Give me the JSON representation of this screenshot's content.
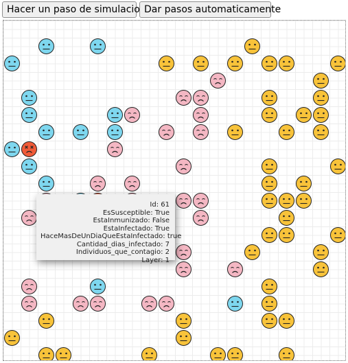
{
  "toolbar": {
    "step_label": "Hacer un paso de simulacion",
    "auto_label": "Dar pasos automaticamente"
  },
  "colors": {
    "susceptible": "#7ed7ef",
    "infected": "#f4b7c3",
    "infected_severe": "#f05a37",
    "immunized": "#f8c33a"
  },
  "agents": [
    {
      "c": 2,
      "r": 1,
      "state": "susceptible"
    },
    {
      "c": 5,
      "r": 1,
      "state": "susceptible"
    },
    {
      "c": 14,
      "r": 1,
      "state": "immunized"
    },
    {
      "c": 0,
      "r": 2,
      "state": "susceptible"
    },
    {
      "c": 9,
      "r": 2,
      "state": "immunized"
    },
    {
      "c": 11,
      "r": 2,
      "state": "immunized"
    },
    {
      "c": 13,
      "r": 2,
      "state": "immunized"
    },
    {
      "c": 15,
      "r": 2,
      "state": "immunized"
    },
    {
      "c": 16,
      "r": 2,
      "state": "immunized"
    },
    {
      "c": 19,
      "r": 2,
      "state": "immunized"
    },
    {
      "c": 12,
      "r": 3,
      "state": "infected"
    },
    {
      "c": 18,
      "r": 3,
      "state": "immunized"
    },
    {
      "c": 1,
      "r": 4,
      "state": "susceptible"
    },
    {
      "c": 10,
      "r": 4,
      "state": "infected"
    },
    {
      "c": 11,
      "r": 4,
      "state": "infected"
    },
    {
      "c": 15,
      "r": 4,
      "state": "immunized"
    },
    {
      "c": 18,
      "r": 4,
      "state": "immunized"
    },
    {
      "c": 1,
      "r": 5,
      "state": "susceptible"
    },
    {
      "c": 6,
      "r": 5,
      "state": "susceptible"
    },
    {
      "c": 7,
      "r": 5,
      "state": "infected"
    },
    {
      "c": 11,
      "r": 5,
      "state": "infected"
    },
    {
      "c": 15,
      "r": 5,
      "state": "immunized"
    },
    {
      "c": 17,
      "r": 5,
      "state": "immunized"
    },
    {
      "c": 18,
      "r": 5,
      "state": "immunized"
    },
    {
      "c": 2,
      "r": 6,
      "state": "susceptible"
    },
    {
      "c": 4,
      "r": 6,
      "state": "susceptible"
    },
    {
      "c": 6,
      "r": 6,
      "state": "susceptible"
    },
    {
      "c": 9,
      "r": 6,
      "state": "infected"
    },
    {
      "c": 11,
      "r": 6,
      "state": "infected"
    },
    {
      "c": 13,
      "r": 6,
      "state": "immunized"
    },
    {
      "c": 16,
      "r": 6,
      "state": "immunized"
    },
    {
      "c": 18,
      "r": 6,
      "state": "immunized"
    },
    {
      "c": 0,
      "r": 7,
      "state": "susceptible"
    },
    {
      "c": 1,
      "r": 7,
      "state": "infected_severe"
    },
    {
      "c": 6,
      "r": 7,
      "state": "infected"
    },
    {
      "c": 1,
      "r": 8,
      "state": "susceptible"
    },
    {
      "c": 10,
      "r": 8,
      "state": "infected"
    },
    {
      "c": 15,
      "r": 8,
      "state": "immunized"
    },
    {
      "c": 19,
      "r": 8,
      "state": "immunized"
    },
    {
      "c": 2,
      "r": 9,
      "state": "susceptible"
    },
    {
      "c": 5,
      "r": 9,
      "state": "infected"
    },
    {
      "c": 7,
      "r": 9,
      "state": "infected"
    },
    {
      "c": 15,
      "r": 9,
      "state": "immunized"
    },
    {
      "c": 17,
      "r": 9,
      "state": "immunized"
    },
    {
      "c": 2,
      "r": 10,
      "state": "infected"
    },
    {
      "c": 4,
      "r": 10,
      "state": "susceptible"
    },
    {
      "c": 5,
      "r": 10,
      "state": "infected_severe"
    },
    {
      "c": 7,
      "r": 10,
      "state": "infected"
    },
    {
      "c": 10,
      "r": 10,
      "state": "infected"
    },
    {
      "c": 11,
      "r": 10,
      "state": "infected"
    },
    {
      "c": 15,
      "r": 10,
      "state": "immunized"
    },
    {
      "c": 16,
      "r": 10,
      "state": "immunized"
    },
    {
      "c": 17,
      "r": 10,
      "state": "immunized"
    },
    {
      "c": 1,
      "r": 11,
      "state": "infected"
    },
    {
      "c": 11,
      "r": 11,
      "state": "infected"
    },
    {
      "c": 16,
      "r": 11,
      "state": "immunized"
    },
    {
      "c": 15,
      "r": 12,
      "state": "immunized"
    },
    {
      "c": 16,
      "r": 12,
      "state": "immunized"
    },
    {
      "c": 19,
      "r": 12,
      "state": "immunized"
    },
    {
      "c": 10,
      "r": 13,
      "state": "infected"
    },
    {
      "c": 14,
      "r": 13,
      "state": "immunized"
    },
    {
      "c": 18,
      "r": 13,
      "state": "immunized"
    },
    {
      "c": 10,
      "r": 14,
      "state": "infected"
    },
    {
      "c": 13,
      "r": 14,
      "state": "infected"
    },
    {
      "c": 18,
      "r": 14,
      "state": "immunized"
    },
    {
      "c": 1,
      "r": 15,
      "state": "infected"
    },
    {
      "c": 5,
      "r": 15,
      "state": "susceptible"
    },
    {
      "c": 15,
      "r": 15,
      "state": "immunized"
    },
    {
      "c": 1,
      "r": 16,
      "state": "infected"
    },
    {
      "c": 4,
      "r": 16,
      "state": "infected"
    },
    {
      "c": 5,
      "r": 16,
      "state": "infected"
    },
    {
      "c": 8,
      "r": 16,
      "state": "infected"
    },
    {
      "c": 9,
      "r": 16,
      "state": "infected"
    },
    {
      "c": 13,
      "r": 16,
      "state": "susceptible"
    },
    {
      "c": 15,
      "r": 16,
      "state": "immunized"
    },
    {
      "c": 2,
      "r": 17,
      "state": "immunized"
    },
    {
      "c": 10,
      "r": 17,
      "state": "immunized"
    },
    {
      "c": 15,
      "r": 17,
      "state": "immunized"
    },
    {
      "c": 16,
      "r": 17,
      "state": "immunized"
    },
    {
      "c": 0,
      "r": 18,
      "state": "immunized"
    },
    {
      "c": 10,
      "r": 18,
      "state": "immunized"
    },
    {
      "c": 2,
      "r": 19,
      "state": "immunized"
    },
    {
      "c": 3,
      "r": 19,
      "state": "immunized"
    },
    {
      "c": 8,
      "r": 19,
      "state": "immunized"
    },
    {
      "c": 12,
      "r": 19,
      "state": "immunized"
    },
    {
      "c": 13,
      "r": 19,
      "state": "immunized"
    },
    {
      "c": 16,
      "r": 19,
      "state": "immunized"
    },
    {
      "c": 1,
      "r": 20,
      "state": "immunized"
    },
    {
      "c": 2,
      "r": 20,
      "state": "immunized"
    },
    {
      "c": 16,
      "r": 20,
      "state": "immunized"
    }
  ],
  "tooltip": {
    "id": "Id: 61",
    "susceptible": "EsSusceptible: True",
    "immunized": "EstaInmunizado: False",
    "infected": "EstaInfectado: True",
    "more_than_one_day": "HaceMasDeUnDiaQueEstaInfectado: true",
    "days_infected": "Cantidad_dias_infectado: 7",
    "contagions": "Individuos_que_contagio: 2",
    "layer": "Layer: 1"
  }
}
